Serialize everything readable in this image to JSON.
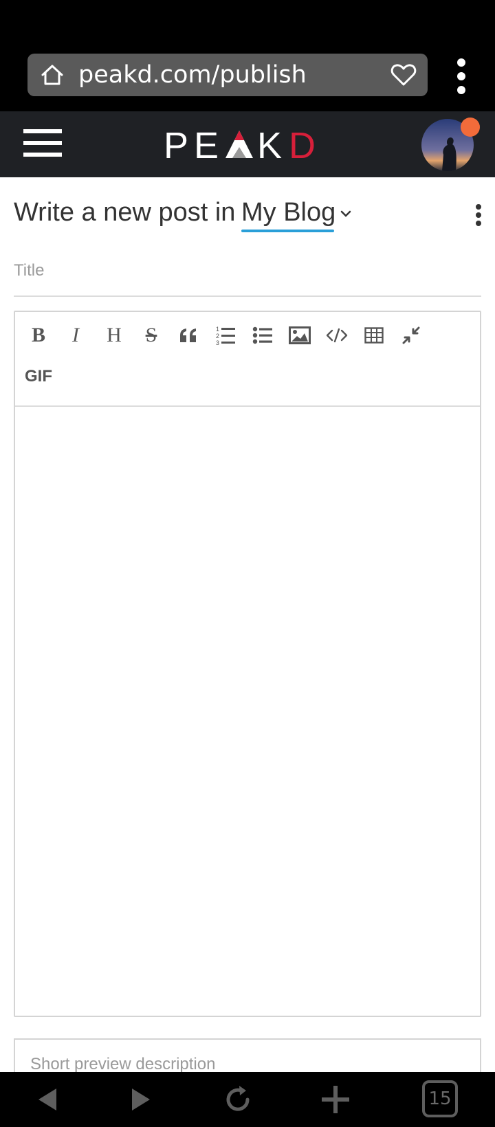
{
  "browser": {
    "url": "peakd.com/publish",
    "tab_count": "15"
  },
  "app": {
    "logo_text": "PEAKD",
    "logo_letters": [
      "P",
      "E",
      "A",
      "K",
      "D"
    ],
    "accent_color": "#d71f3a",
    "notification_color": "#f26b3a"
  },
  "page": {
    "heading_prefix": "Write a new post in",
    "blog_name": "My Blog",
    "underline_color": "#2a9fd8"
  },
  "form": {
    "title_placeholder": "Title",
    "description_placeholder": "Short preview description"
  },
  "editor": {
    "toolbar": [
      {
        "name": "bold",
        "icon": "bold-icon",
        "label": "B"
      },
      {
        "name": "italic",
        "icon": "italic-icon",
        "label": "I"
      },
      {
        "name": "heading",
        "icon": "heading-icon",
        "label": "H"
      },
      {
        "name": "strikethrough",
        "icon": "strikethrough-icon",
        "label": "S"
      },
      {
        "name": "quote",
        "icon": "quote-icon"
      },
      {
        "name": "ordered-list",
        "icon": "ordered-list-icon"
      },
      {
        "name": "unordered-list",
        "icon": "unordered-list-icon"
      },
      {
        "name": "image",
        "icon": "image-icon"
      },
      {
        "name": "code",
        "icon": "code-icon"
      },
      {
        "name": "table",
        "icon": "table-icon"
      },
      {
        "name": "fullscreen",
        "icon": "shrink-icon"
      }
    ],
    "gif_label": "GIF"
  }
}
